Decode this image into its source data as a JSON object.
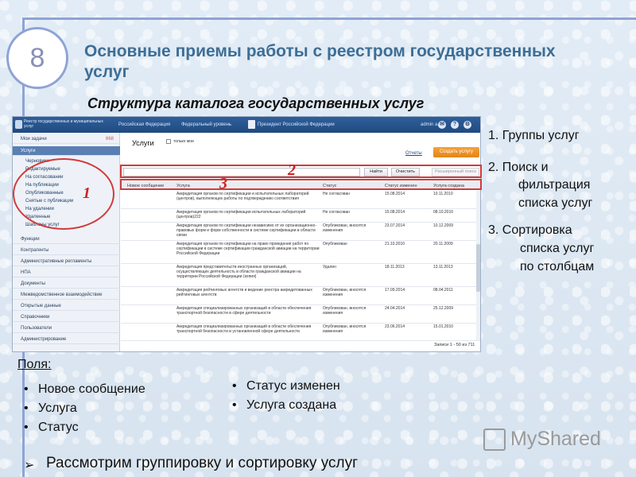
{
  "slide": {
    "number": "8",
    "title": "Основные приемы работы с реестром государственных услуг",
    "subtitle": "Структура каталога государственных услуг"
  },
  "app": {
    "header": {
      "logo_text": "Реестр государственных и муниципальных услуг",
      "nav": [
        "Российская Федерация",
        "Федеральный уровень",
        "Президент Российской Федерации"
      ],
      "user": "admin a. a."
    },
    "sidebar": {
      "items": [
        {
          "label": "Мои задачи",
          "count": "668"
        },
        {
          "label": "Услуги"
        },
        {
          "label": "Функции"
        },
        {
          "label": "Контрагенты"
        },
        {
          "label": "Административные регламенты"
        },
        {
          "label": "НПА"
        },
        {
          "label": "Документы"
        },
        {
          "label": "Межведомственное взаимодействие"
        },
        {
          "label": "Открытые данные"
        },
        {
          "label": "Справочники"
        },
        {
          "label": "Пользователи"
        },
        {
          "label": "Администрирование"
        }
      ],
      "subitems": [
        "Черновики",
        "Редактируемые",
        "На согласовании",
        "На публикации",
        "Опубликованные",
        "Снятые с публикации",
        "На удалении",
        "Удаленные",
        "Шаблоны услуг"
      ]
    },
    "main": {
      "title": "Услуги",
      "only_mine": "только мои",
      "reports": "Отчеты",
      "create_button": "Создать услугу",
      "find_button": "Найти",
      "clear_button": "Очистить",
      "advanced_search": "Расширенный поиск",
      "columns": [
        "Новое сообщение",
        "Услуга",
        "Статус",
        "Статус изменен",
        "Услуга создана"
      ],
      "rows": [
        {
          "service": "Аккредитация органов по сертификации и испытательных лабораторий (центров), выполняющих работы по подтверждению соответствия",
          "status": "Не согласован",
          "changed": "15.08.2014",
          "created": "10.11.2010"
        },
        {
          "service": "Аккредитация органов по сертификации испытательных лабораторий (центров)222",
          "status": "Не согласован",
          "changed": "15.08.2014",
          "created": "08.10.2010"
        },
        {
          "service": "Аккредитация органов по сертификации независимо от их организационно-правовых форм и форм собственности в системе сертификации в области связи",
          "status": "Опубликован, вносятся изменения",
          "changed": "23.07.2014",
          "created": "10.12.2009"
        },
        {
          "service": "Аккредитация органов по сертификации на право проведения работ по сертификации в системе сертификации гражданской авиации на территории Российской Федерации",
          "status": "Опубликован",
          "changed": "21.10.2010",
          "created": "20.11.2009"
        },
        {
          "service": "Аккредитация представительств иностранных организаций, осуществляющих деятельность в области гражданской авиации на территории Российской Федерации (копия)",
          "status": "Удален",
          "changed": "18.11.2013",
          "created": "13.11.2013"
        },
        {
          "service": "Аккредитация рейтинговых агентств и ведение реестра аккредитованных рейтинговых агентств",
          "status": "Опубликован, вносятся изменения",
          "changed": "17.09.2014",
          "created": "08.04.2011"
        },
        {
          "service": "Аккредитация специализированных организаций в области обеспечения транспортной безопасности в сфере деятельности",
          "status": "Опубликован, вносятся изменения",
          "changed": "24.04.2014",
          "created": "25.12.2009"
        },
        {
          "service": "Аккредитация специализированных организаций в области обеспечения транспортной безопасности в установленной сфере деятельности",
          "status": "Опубликован, вносятся изменения",
          "changed": "23.06.2014",
          "created": "15.01.2010"
        }
      ],
      "pager": "Записи 1 - 50 из 711"
    }
  },
  "annotations": {
    "label1": "1",
    "label2": "2",
    "label3": "3"
  },
  "notes": {
    "n1": "1. Группы услуг",
    "n2_l1": "2. Поиск и",
    "n2_l2": "фильтрация",
    "n2_l3": "списка услуг",
    "n3_l1": "3. Сортировка",
    "n3_l2": "списка услуг",
    "n3_l3": "по столбцам"
  },
  "fields": {
    "label": "Поля:",
    "left": [
      "Новое сообщение",
      "Услуга",
      "Статус"
    ],
    "right": [
      "Статус изменен",
      "Услуга создана"
    ]
  },
  "footer": {
    "text": "Рассмотрим группировку и сортировку услуг",
    "watermark": "MyShared"
  },
  "colors": {
    "title": "#3e6e95",
    "annotation": "#d23b3b",
    "frame": "#8ea3d6",
    "header": "#1f4a80",
    "accent_button": "#e38416"
  }
}
